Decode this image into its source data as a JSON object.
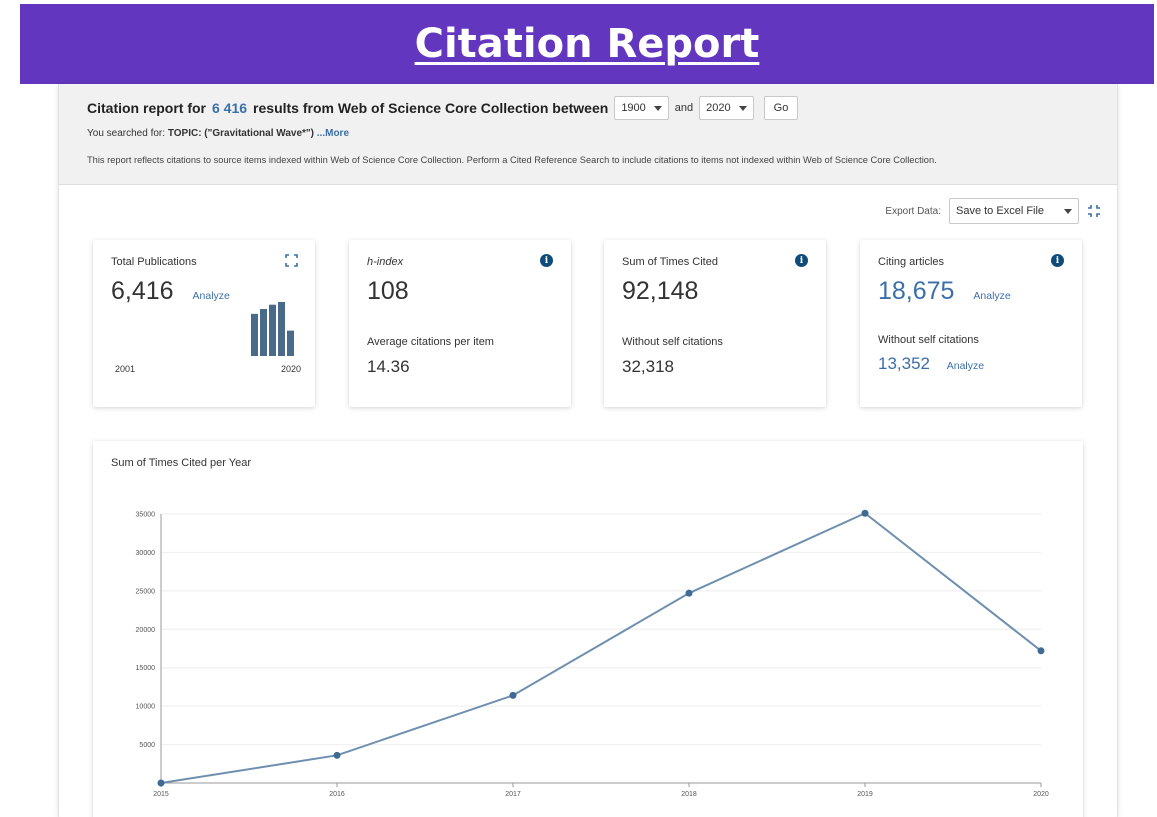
{
  "banner": {
    "title": "Citation Report"
  },
  "header": {
    "title_prefix": "Citation report for",
    "result_count": "6 416",
    "title_suffix": "results from Web of Science Core Collection between",
    "from_year": "1900",
    "and_label": "and",
    "to_year": "2020",
    "go_label": "Go",
    "searched_prefix": "You searched for:",
    "searched_topic": "TOPIC: (\"Gravitational Wave*\")",
    "more_link": "...More",
    "note": "This report reflects citations to source items indexed within Web of Science Core Collection. Perform a Cited Reference Search to include citations to items not indexed within Web of Science Core Collection."
  },
  "export": {
    "label": "Export Data:",
    "selected": "Save to Excel File"
  },
  "cards": {
    "total": {
      "label": "Total Publications",
      "value": "6,416",
      "analyze": "Analyze",
      "start_year": "2001",
      "end_year": "2020",
      "mini_bars": [
        0.78,
        0.87,
        0.95,
        1.0,
        0.47
      ]
    },
    "hindex": {
      "label": "h-index",
      "value": "108",
      "sub_label": "Average citations per item",
      "sub_value": "14.36"
    },
    "times_cited": {
      "label": "Sum of Times Cited",
      "value": "92,148",
      "sub_label": "Without self citations",
      "sub_value": "32,318"
    },
    "citing": {
      "label": "Citing articles",
      "value": "18,675",
      "analyze": "Analyze",
      "sub_label": "Without self citations",
      "sub_value": "13,352",
      "sub_analyze": "Analyze"
    }
  },
  "colors": {
    "accent": "#3c6fa8",
    "banner": "#6236bf",
    "line": "#6e8fae",
    "info": "#0f4c7a",
    "bars": "#4a6a8a"
  },
  "chart_data": {
    "type": "line",
    "title": "Sum of Times Cited per Year",
    "x": [
      "2015",
      "2016",
      "2017",
      "2018",
      "2019",
      "2020"
    ],
    "series": [
      {
        "values": [
          0,
          3600,
          11400,
          24700,
          35100,
          17200
        ]
      }
    ],
    "yticks": [
      5000,
      10000,
      15000,
      20000,
      25000,
      30000,
      35000
    ],
    "ylim": [
      0,
      35000
    ],
    "grid": true
  }
}
